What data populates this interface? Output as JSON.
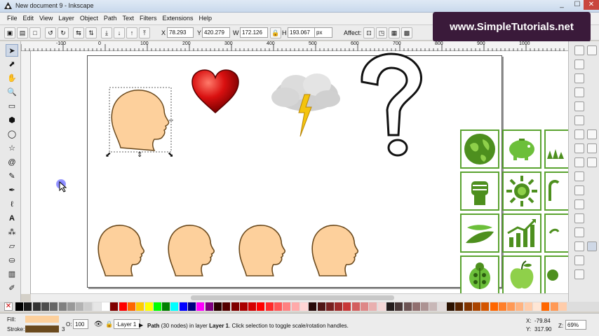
{
  "window": {
    "title": "New document 9 - Inkscape",
    "controls": [
      "_",
      "☐",
      "✕"
    ]
  },
  "watermark": "www.SimpleTutorials.net",
  "menu": [
    "File",
    "Edit",
    "View",
    "Layer",
    "Object",
    "Path",
    "Text",
    "Filters",
    "Extensions",
    "Help"
  ],
  "tool_controls": {
    "x_label": "X",
    "x_value": "78.293",
    "y_label": "Y",
    "y_value": "420.279",
    "w_label": "W",
    "w_value": "172.126",
    "h_label": "H",
    "h_value": "193.067",
    "unit": "px",
    "affect_label": "Affect:"
  },
  "ruler_ticks": [
    "-100",
    "0",
    "100",
    "200",
    "300",
    "400",
    "500",
    "600",
    "700",
    "800",
    "900",
    "1000"
  ],
  "icons": {
    "selector": "arrow-icon",
    "node": "node-icon",
    "tweak": "tweak-icon",
    "zoom": "zoom-icon",
    "rect": "rectangle-icon",
    "box3d": "box3d-icon",
    "ellipse": "ellipse-icon",
    "star": "star-icon",
    "spiral": "spiral-icon",
    "pencil": "pencil-icon",
    "pen": "pen-icon",
    "calligraphy": "calligraphy-icon",
    "text": "text-icon",
    "spray": "spray-icon",
    "eraser": "eraser-icon",
    "bucket": "bucket-icon",
    "gradient": "gradient-icon",
    "dropper": "dropper-icon"
  },
  "status": {
    "fill_label": "Fill:",
    "stroke_label": "Stroke:",
    "stroke_width": "3",
    "opacity_label": "O:",
    "opacity_value": "100",
    "layer": "Layer 1",
    "message_prefix": "Path",
    "message_nodes": "(30 nodes) in layer",
    "message_layer": "Layer 1",
    "message_suffix": ". Click selection to toggle scale/rotation handles.",
    "x_coord_label": "X:",
    "x_coord": "-79.84",
    "y_coord_label": "Y:",
    "y_coord": "317.90",
    "zoom_label": "Z:",
    "zoom": "69%"
  },
  "colors": {
    "head_fill": "#fdd09c",
    "head_stroke": "#6b4a1e",
    "heart": "#d91010",
    "green": "#5aa330",
    "fill_swatch": "#fdd09c",
    "stroke_swatch": "#6b4a1e"
  },
  "palette": [
    "#000000",
    "#1a1a1a",
    "#333333",
    "#4d4d4d",
    "#666666",
    "#808080",
    "#999999",
    "#b3b3b3",
    "#cccccc",
    "#e6e6e6",
    "#ffffff",
    "#800000",
    "#ff0000",
    "#ff6600",
    "#ffcc00",
    "#ffff00",
    "#00ff00",
    "#008000",
    "#00ffff",
    "#0000ff",
    "#000080",
    "#ff00ff",
    "#800080",
    "#2a0000",
    "#550000",
    "#800000",
    "#aa0000",
    "#d40000",
    "#ff0000",
    "#ff2a2a",
    "#ff5555",
    "#ff8080",
    "#ffaaaa",
    "#ffd5d5",
    "#280b0b",
    "#501616",
    "#782121",
    "#a02c2c",
    "#c83737",
    "#d35f5f",
    "#de8787",
    "#e9afaf",
    "#f4d7d7",
    "#241c1c",
    "#483737",
    "#6c5353",
    "#916f6f",
    "#ac9393",
    "#c8b7b7",
    "#e3dbdb",
    "#2b1100",
    "#552200",
    "#803300",
    "#aa4400",
    "#d45500",
    "#ff6600",
    "#ff7f2a",
    "#ff9955",
    "#ffb380",
    "#ffccaa",
    "#ffe6d5",
    "#ff6600",
    "#ff9955",
    "#ffccaa"
  ]
}
